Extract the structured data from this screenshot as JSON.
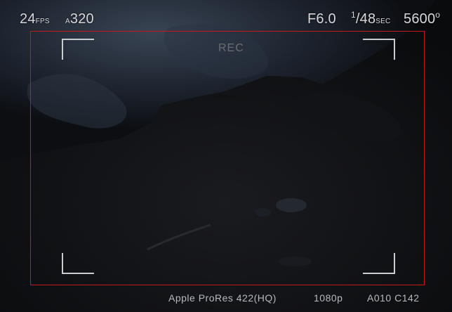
{
  "hud": {
    "fps_value": "24",
    "fps_unit": "FPS",
    "iso_prefix": "A",
    "iso_value": "320",
    "aperture": "F6.0",
    "shutter_num": "1",
    "shutter_den": "/48",
    "shutter_unit": "SEC",
    "white_balance": "5600",
    "white_balance_unit": "o",
    "rec_label": "REC"
  },
  "footer": {
    "codec": "Apple ProRes 422(HQ)",
    "resolution": "1080p",
    "clip_id": "A010 C142"
  },
  "colors": {
    "frame": "#c01a1a",
    "hud_text": "#d7d9dd",
    "rec_text": "#6a6d72"
  }
}
